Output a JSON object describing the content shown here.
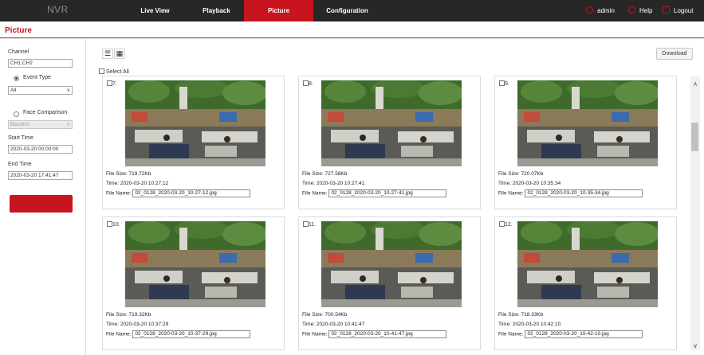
{
  "app": {
    "brand": "NVR"
  },
  "nav": [
    {
      "label": "Live View",
      "active": false
    },
    {
      "label": "Playback",
      "active": false
    },
    {
      "label": "Picture",
      "active": true
    },
    {
      "label": "Configuration",
      "active": false
    }
  ],
  "topright": {
    "user": "admin",
    "help": "Help",
    "logout": "Logout"
  },
  "page": {
    "title": "Picture"
  },
  "left": {
    "channel_label": "Channel",
    "channel_value": "CH1,CH2",
    "event_type_label": "Event Type",
    "event_type_value": "All",
    "face_comparison_label": "Face Comparison",
    "face_list_value": "Blacklist",
    "start_time_label": "Start Time",
    "start_time_value": "2020-03-20 00:00:00",
    "end_time_label": "End Time",
    "end_time_value": "2020-03-20 17:41:47"
  },
  "toolbar": {
    "download_label": "Download",
    "select_all_label": "Select All"
  },
  "cards": [
    {
      "index": "7.",
      "size_label": "File Size:",
      "size": "719.72Kb",
      "time_label": "Time:",
      "time": "2020-03-20 10:27:12",
      "name_label": "File Name:",
      "file": "02_0128_2020-03-20_10-27-12.jpg"
    },
    {
      "index": "8.",
      "size_label": "File Size:",
      "size": "727.58Kb",
      "time_label": "Time:",
      "time": "2020-03-20 10:27:41",
      "name_label": "File Name:",
      "file": "02_0128_2020-03-20_10-27-41.jpg"
    },
    {
      "index": "9.",
      "size_label": "File Size:",
      "size": "720.07Kb",
      "time_label": "Time:",
      "time": "2020-03-20 10:35:34",
      "name_label": "File Name:",
      "file": "02_0128_2020-03-20_10-35-34.jpg"
    },
    {
      "index": "10.",
      "size_label": "File Size:",
      "size": "719.32Kb",
      "time_label": "Time:",
      "time": "2020-03-20 10:37:29",
      "name_label": "File Name:",
      "file": "02_0128_2020-03-20_10-37-29.jpg"
    },
    {
      "index": "11.",
      "size_label": "File Size:",
      "size": "700.54Kb",
      "time_label": "Time:",
      "time": "2020-03-20 10:41:47",
      "name_label": "File Name:",
      "file": "02_0128_2020-03-20_10-41-47.jpg"
    },
    {
      "index": "12.",
      "size_label": "File Size:",
      "size": "718.33Kb",
      "time_label": "Time:",
      "time": "2020-03-20 10:42:10",
      "name_label": "File Name:",
      "file": "02_0128_2020-03-20_10-42-10.jpg"
    }
  ],
  "colors": {
    "accent": "#c7141e",
    "topbar": "#272727"
  }
}
